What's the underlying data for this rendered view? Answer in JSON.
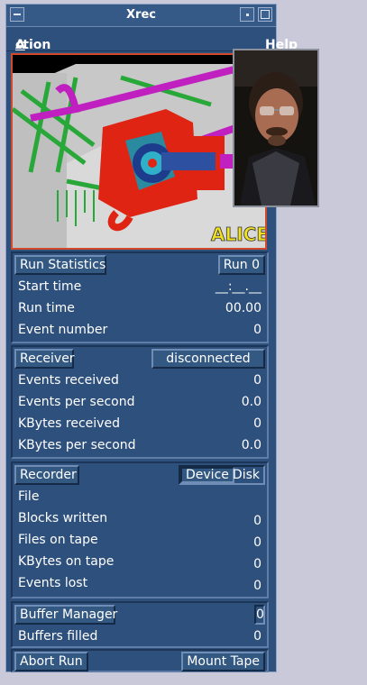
{
  "window": {
    "title": "Xrec"
  },
  "menu": {
    "action": "Action",
    "action_rest": "ction",
    "action_key": "A",
    "help": "Help"
  },
  "banner": {
    "logo_text": "ALICE"
  },
  "run_statistics": {
    "header_button": "Run Statistics",
    "run_label": "Run 0",
    "rows": [
      {
        "label": "Start time",
        "value": "__:__.__"
      },
      {
        "label": "Run time",
        "value": "00.00"
      },
      {
        "label": "Event number",
        "value": "0"
      }
    ]
  },
  "receiver": {
    "header_button": "Receiver",
    "status": "disconnected",
    "rows": [
      {
        "label": "Events received",
        "value": "0"
      },
      {
        "label": "Events per second",
        "value": "0.0"
      },
      {
        "label": "KBytes received",
        "value": "0"
      },
      {
        "label": "KBytes per second",
        "value": "0.0"
      }
    ]
  },
  "recorder": {
    "header_button": "Recorder",
    "device_button": "Device",
    "device_value": "Disk",
    "rows": [
      {
        "label": "File",
        "value": ""
      },
      {
        "label": "Blocks written",
        "value": "0"
      },
      {
        "label": "Files on tape",
        "value": "0"
      },
      {
        "label": "KBytes on tape",
        "value": "0"
      },
      {
        "label": "Events lost",
        "value": "0"
      }
    ]
  },
  "buffer_manager": {
    "header_button": "Buffer Manager",
    "header_value": "0",
    "rows": [
      {
        "label": "Buffers filled",
        "value": "0"
      }
    ]
  },
  "bottom": {
    "abort": "Abort Run",
    "mount": "Mount Tape"
  },
  "colors": {
    "window_bg": "#2e507c",
    "frame_red": "#d24a2a",
    "desktop": "#c9c9d9"
  }
}
